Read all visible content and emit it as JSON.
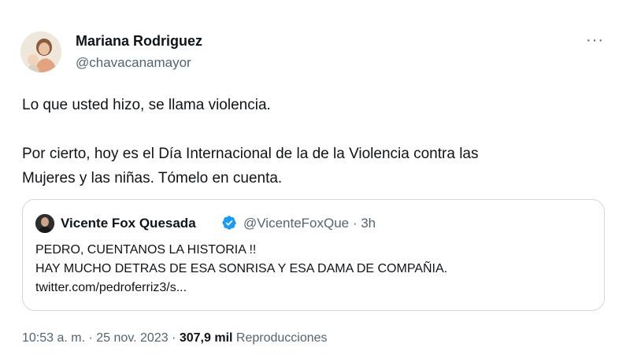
{
  "author": {
    "name": "Mariana Rodriguez",
    "handle": "@chavacanamayor",
    "more_label": "···"
  },
  "tweet": {
    "line1": "Lo que usted hizo, se llama violencia.",
    "line2": "Por cierto, hoy es el Día Internacional de la de la Violencia contra las",
    "line3": "Mujeres y las niñas. Tómelo en cuenta."
  },
  "quoted": {
    "name": "Vicente Fox Quesada",
    "handle_time": "@VicenteFoxQue · 3h",
    "line1": "PEDRO, CUENTANOS LA HISTORIA !!",
    "line2": "HAY MUCHO DETRAS DE ESA SONRISA Y ESA DAMA DE COMPAÑIA.",
    "line3": "twitter.com/pedroferriz3/s...",
    "verified_color": "#1d9bf0"
  },
  "meta": {
    "time": "10:53 a. m.",
    "date": "25 nov. 2023",
    "views_count": "307,9 mil",
    "views_label": "Reproducciones"
  }
}
